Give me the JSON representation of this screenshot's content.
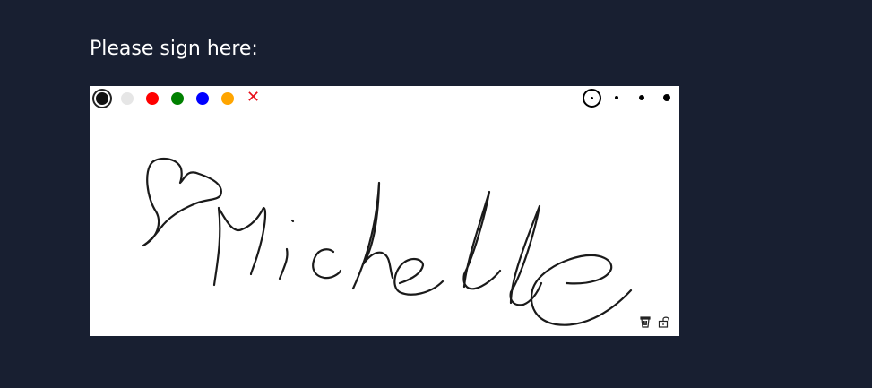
{
  "prompt": {
    "text": "Please sign here:"
  },
  "toolbar": {
    "colors": [
      {
        "name": "black",
        "hex": "#000000",
        "selected": true
      },
      {
        "name": "light-gray",
        "hex": "#e6e6e6",
        "selected": false
      },
      {
        "name": "red",
        "hex": "#ff0000",
        "selected": false
      },
      {
        "name": "green",
        "hex": "#008000",
        "selected": false
      },
      {
        "name": "blue",
        "hex": "#0000ff",
        "selected": false
      },
      {
        "name": "orange",
        "hex": "#ffa500",
        "selected": false
      }
    ],
    "clear_glyph": "✕",
    "clear_icon": "close-icon",
    "pen_sizes": [
      "extra-small",
      "small",
      "medium",
      "large",
      "extra-large"
    ],
    "selected_pen_size": "small"
  },
  "pad": {
    "background": "#ffffff",
    "ink_color": "#1a1a1a",
    "signature_text": "Michelle",
    "corner_icons": [
      "trash-icon",
      "unlock-icon"
    ]
  },
  "theme": {
    "page_background": "#181f31",
    "prompt_color": "#ffffff",
    "clear_color": "#e8101b"
  }
}
